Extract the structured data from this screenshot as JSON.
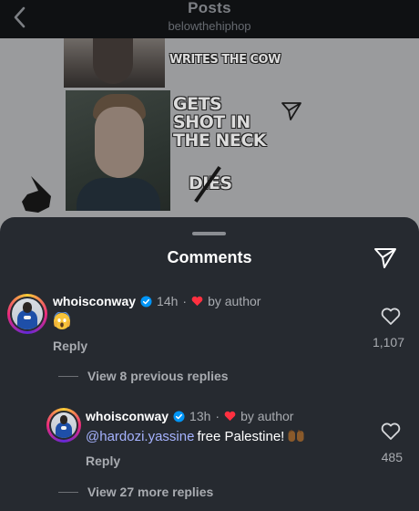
{
  "header": {
    "title": "Posts",
    "subtitle": "belowthehiphop"
  },
  "post": {
    "meme_caption_top": "WRITES THE COW",
    "meme_caption_middle": "GETS SHOT IN THE NECK",
    "meme_caption_bottom": "DIES"
  },
  "comments_sheet": {
    "title": "Comments",
    "comments": [
      {
        "username": "whoisconway",
        "verified": true,
        "time": "14h",
        "liked_by_author_label": "by author",
        "body_emoji": "scream-emoji",
        "reply_label": "Reply",
        "like_count": "1,107",
        "view_replies_label": "View 8 previous replies"
      },
      {
        "username": "whoisconway",
        "verified": true,
        "time": "13h",
        "liked_by_author_label": "by author",
        "mention": "@hardozi.yassine",
        "text": "free Palestine!",
        "trailing_emoji": "raised-hands-emoji",
        "reply_label": "Reply",
        "like_count": "485",
        "view_replies_label": "View 27 more replies"
      }
    ]
  },
  "colors": {
    "sheet_background": "#262a30",
    "heart_red": "#ff3040",
    "verified_blue": "#0095f6",
    "mention_color": "#a6b3ff"
  }
}
